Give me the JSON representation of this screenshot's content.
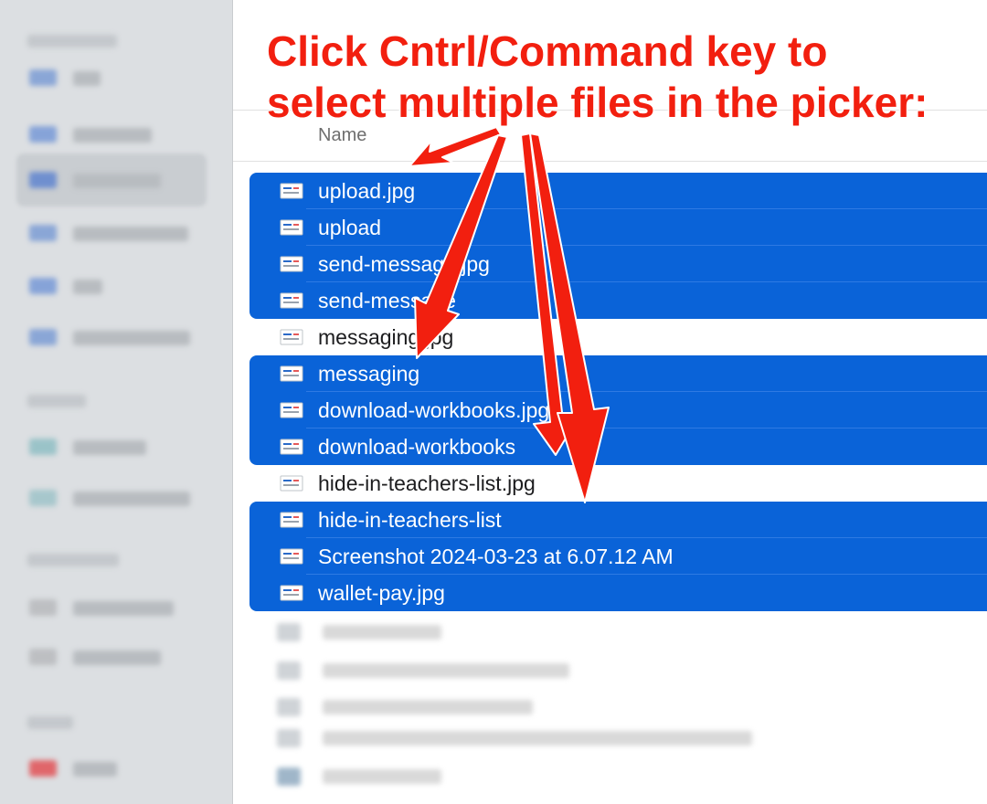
{
  "annotation": {
    "line1": "Click Cntrl/Command key to",
    "line2": "select multiple files in the picker:",
    "color": "#f21f0f"
  },
  "list": {
    "column_header": "Name",
    "selection_color": "#0a63d8"
  },
  "files": [
    {
      "name": "upload.jpg",
      "selected": true,
      "icon": "image-thumbnail-icon"
    },
    {
      "name": "upload",
      "selected": true,
      "icon": "image-thumbnail-icon"
    },
    {
      "name": "send-message.jpg",
      "selected": true,
      "icon": "image-thumbnail-icon"
    },
    {
      "name": "send-message",
      "selected": true,
      "icon": "image-thumbnail-icon"
    },
    {
      "name": "messaging.jpg",
      "selected": false,
      "icon": "image-thumbnail-icon"
    },
    {
      "name": "messaging",
      "selected": true,
      "icon": "image-thumbnail-icon"
    },
    {
      "name": "download-workbooks.jpg",
      "selected": true,
      "icon": "image-thumbnail-icon"
    },
    {
      "name": "download-workbooks",
      "selected": true,
      "icon": "image-thumbnail-icon"
    },
    {
      "name": "hide-in-teachers-list.jpg",
      "selected": false,
      "icon": "image-thumbnail-icon"
    },
    {
      "name": "hide-in-teachers-list",
      "selected": true,
      "icon": "image-thumbnail-icon"
    },
    {
      "name": "Screenshot 2024-03-23 at 6.07.12 AM",
      "selected": true,
      "icon": "image-thumbnail-icon"
    },
    {
      "name": "wallet-pay.jpg",
      "selected": true,
      "icon": "image-thumbnail-icon"
    }
  ]
}
